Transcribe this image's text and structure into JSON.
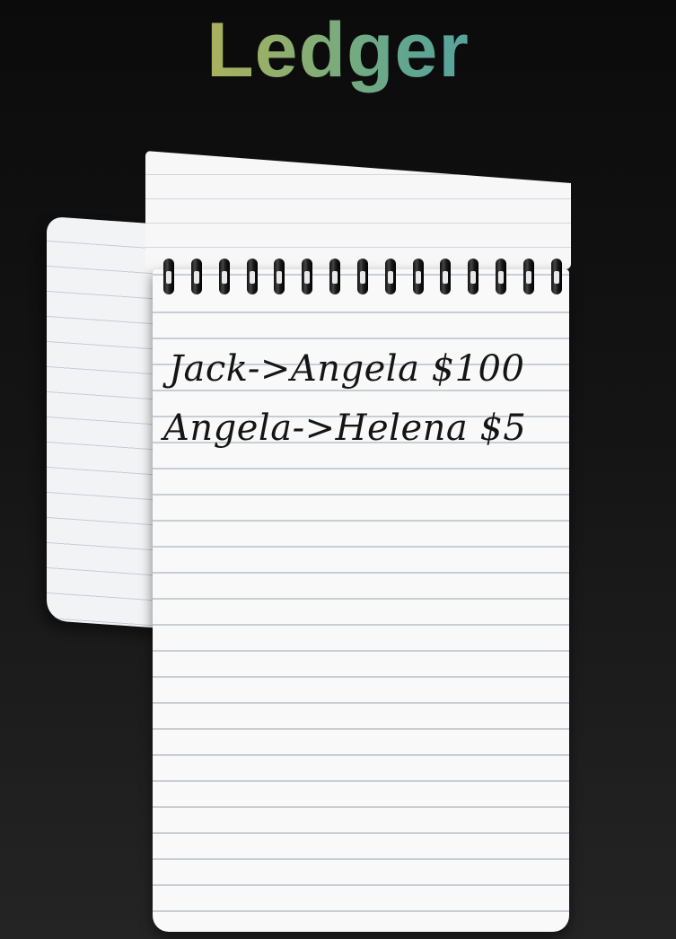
{
  "title": "Ledger",
  "ledger_entries": [
    {
      "text": "Jack->Angela $100"
    },
    {
      "text": "Angela->Helena $5"
    }
  ],
  "colors": {
    "background_top": "#0b0b0b",
    "background_bottom": "#242424",
    "title_gradient": [
      "#d9a845",
      "#93b06a",
      "#3f97c6"
    ],
    "paper": "#f9f9f9",
    "rule_line": "#c9ced6",
    "ink": "#151515"
  },
  "icons": {
    "binding": "spiral-binding-icon"
  }
}
